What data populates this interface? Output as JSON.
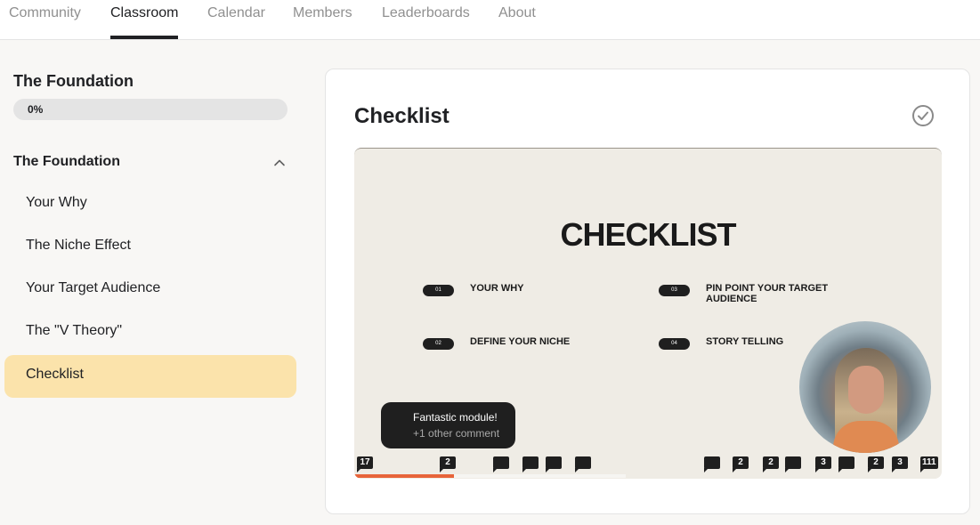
{
  "nav": {
    "tabs": [
      {
        "label": "Community",
        "active": false
      },
      {
        "label": "Classroom",
        "active": true
      },
      {
        "label": "Calendar",
        "active": false
      },
      {
        "label": "Members",
        "active": false
      },
      {
        "label": "Leaderboards",
        "active": false
      },
      {
        "label": "About",
        "active": false
      }
    ]
  },
  "sidebar": {
    "course_title": "The Foundation",
    "progress_label": "0%",
    "progress_value": 0,
    "module_title": "The Foundation",
    "lessons": [
      {
        "label": "Your Why",
        "active": false
      },
      {
        "label": "The Niche Effect",
        "active": false
      },
      {
        "label": "Your Target Audience",
        "active": false
      },
      {
        "label": "The \"V Theory\"",
        "active": false
      },
      {
        "label": "Checklist",
        "active": true
      }
    ]
  },
  "lesson": {
    "title": "Checklist",
    "video": {
      "slide_title": "CHECKLIST",
      "items": [
        {
          "num": "01",
          "text": "YOUR WHY"
        },
        {
          "num": "02",
          "text": "DEFINE YOUR NICHE"
        },
        {
          "num": "03",
          "text": "PIN POINT YOUR TARGET AUDIENCE"
        },
        {
          "num": "04",
          "text": "STORY TELLING"
        }
      ],
      "comment_popup": {
        "line1": "Fantastic module!",
        "line2": "+1 other comment"
      },
      "markers": [
        "17",
        "2",
        "",
        "",
        "",
        "",
        "",
        "2",
        "2",
        "",
        "3",
        "",
        "2",
        "3",
        "111"
      ],
      "playback_progress": 0.17
    }
  },
  "colors": {
    "accent_active_lesson": "#fbe3ab",
    "timeline_progress": "#e7643a"
  },
  "icons": {
    "chevron": "chevron-up-icon",
    "complete": "check-circle-icon",
    "marker": "comment-bubble-icon"
  }
}
